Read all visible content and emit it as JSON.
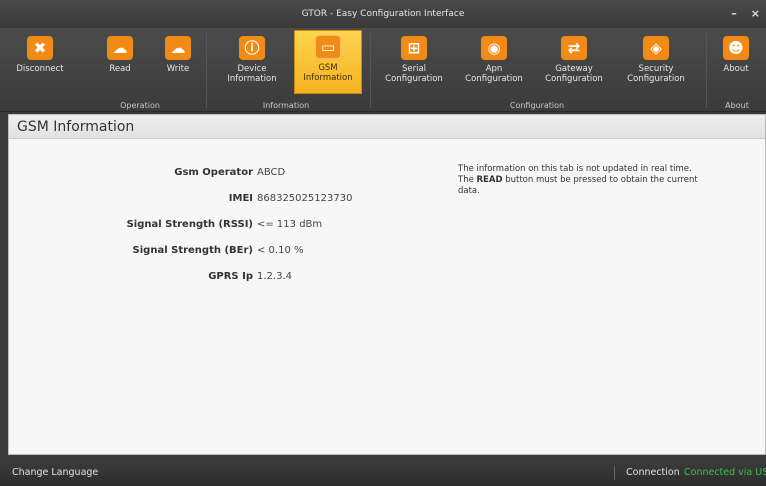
{
  "window": {
    "title": "GTOR - Easy Configuration Interface",
    "minimize_label": "–",
    "close_label": "×"
  },
  "ribbon": {
    "groups": [
      {
        "label": "Operation"
      },
      {
        "label": "Information"
      },
      {
        "label": "Configuration"
      },
      {
        "label": "About"
      }
    ],
    "buttons": [
      {
        "label": "Disconnect",
        "icon": "disconnect-icon",
        "glyph": "✖"
      },
      {
        "label": "Read",
        "icon": "cloud-download-icon",
        "glyph": "☁"
      },
      {
        "label": "Write",
        "icon": "cloud-upload-icon",
        "glyph": "☁"
      },
      {
        "label": "Device Information",
        "icon": "info-icon",
        "glyph": "ⓘ"
      },
      {
        "label": "GSM Information",
        "icon": "sim-card-icon",
        "glyph": "▭",
        "active": true
      },
      {
        "label": "Serial Configuration",
        "icon": "network-icon",
        "glyph": "⊞"
      },
      {
        "label": "Apn Configuration",
        "icon": "globe-icon",
        "glyph": "◉"
      },
      {
        "label": "Gateway Configuration",
        "icon": "gateway-icon",
        "glyph": "⇄"
      },
      {
        "label": "Security Configuration",
        "icon": "shield-icon",
        "glyph": "◈"
      },
      {
        "label": "About",
        "icon": "users-icon",
        "glyph": "☻"
      }
    ],
    "accent_color": "#f28b16",
    "active_color": "#ffd44d"
  },
  "panel": {
    "title": "GSM Information",
    "fields": [
      {
        "label": "Gsm Operator",
        "value": "ABCD"
      },
      {
        "label": "IMEI",
        "value": "868325025123730"
      },
      {
        "label": "Signal Strength (RSSI)",
        "value": "<= 113 dBm"
      },
      {
        "label": "Signal Strength (BEr)",
        "value": "< 0.10 %"
      },
      {
        "label": "GPRS Ip",
        "value": "1.2.3.4"
      }
    ],
    "note_part1": "The information on this tab is not updated in real time. The ",
    "note_bold": "READ",
    "note_part2": " button must be pressed to obtain the current data."
  },
  "statusbar": {
    "change_language": "Change Language",
    "connection_label": "Connection",
    "connection_value": "Connected via USB",
    "connection_color": "#35c24a"
  }
}
